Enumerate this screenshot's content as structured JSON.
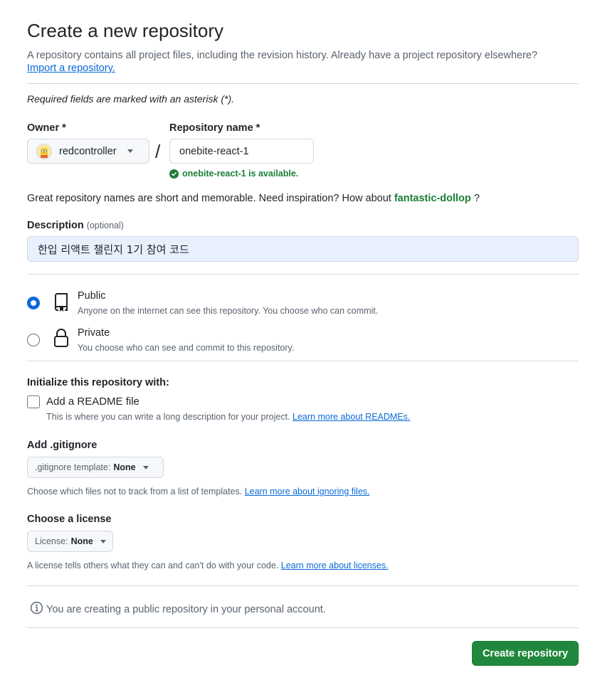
{
  "header": {
    "title": "Create a new repository",
    "subtitle": "A repository contains all project files, including the revision history. Already have a project repository elsewhere?",
    "import_link": "Import a repository."
  },
  "required_note": "Required fields are marked with an asterisk (*).",
  "owner": {
    "label": "Owner *",
    "value": "redcontroller"
  },
  "repo": {
    "label": "Repository name *",
    "value": "onebite-react-1",
    "availability": "onebite-react-1 is available."
  },
  "inspiration": {
    "text": "Great repository names are short and memorable. Need inspiration? How about",
    "suggestion": "fantastic-dollop",
    "suffix": "?"
  },
  "description": {
    "label": "Description",
    "optional": "(optional)",
    "value": "한입 리액트 챌린지 1기 참여 코드"
  },
  "visibility": {
    "selected": "Public",
    "options": [
      {
        "title": "Public",
        "desc": "Anyone on the internet can see this repository. You choose who can commit."
      },
      {
        "title": "Private",
        "desc": "You choose who can see and commit to this repository."
      }
    ]
  },
  "initialize": {
    "heading": "Initialize this repository with:",
    "readme_label": "Add a README file",
    "readme_checked": false,
    "readme_desc": "This is where you can write a long description for your project.",
    "readme_link": "Learn more about READMEs."
  },
  "gitignore": {
    "heading": "Add .gitignore",
    "select_prefix": ".gitignore template:",
    "select_value": "None",
    "note": "Choose which files not to track from a list of templates.",
    "link": "Learn more about ignoring files."
  },
  "license": {
    "heading": "Choose a license",
    "select_prefix": "License:",
    "select_value": "None",
    "note": "A license tells others what they can and can't do with your code.",
    "link": "Learn more about licenses."
  },
  "info": "You are creating a public repository in your personal account.",
  "submit_label": "Create repository",
  "colors": {
    "accent": "#0969da",
    "success": "#1a7f37",
    "primary_button": "#1f883d"
  }
}
